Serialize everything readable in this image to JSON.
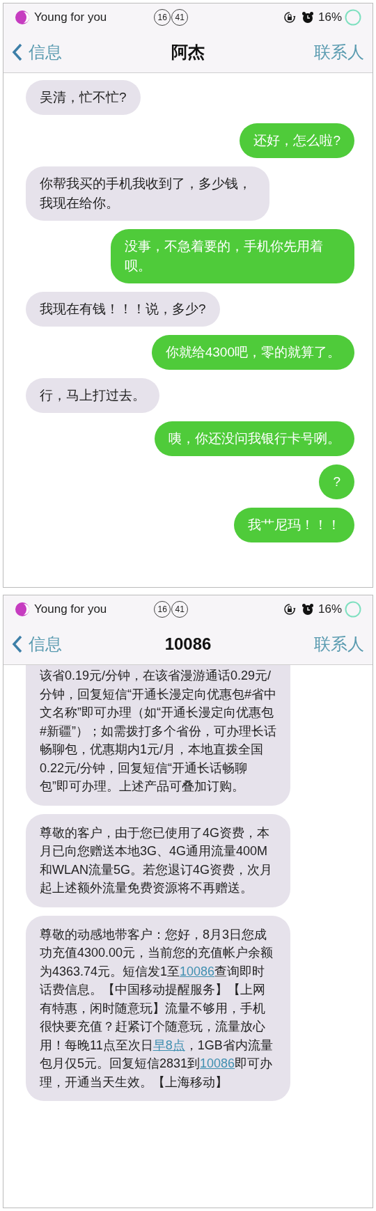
{
  "screens": [
    {
      "status_bar": {
        "carrier": "Young for you",
        "hour": "16",
        "minute": "41",
        "battery": "16%"
      },
      "nav": {
        "back": "信息",
        "title": "阿杰",
        "action": "联系人"
      },
      "messages": [
        {
          "kind": "received",
          "segments": [
            {
              "kind": "text",
              "text": "吴清，忙不忙?"
            }
          ]
        },
        {
          "kind": "sent",
          "segments": [
            {
              "kind": "text",
              "text": "还好，怎么啦?"
            }
          ]
        },
        {
          "kind": "received",
          "segments": [
            {
              "kind": "text",
              "text": "你帮我买的手机我收到了，多少钱，我现在给你。"
            }
          ]
        },
        {
          "kind": "sent",
          "segments": [
            {
              "kind": "text",
              "text": "没事，不急着要的，手机你先用着呗。"
            }
          ]
        },
        {
          "kind": "received",
          "segments": [
            {
              "kind": "text",
              "text": "我现在有钱！！！说，多少?"
            }
          ]
        },
        {
          "kind": "sent",
          "segments": [
            {
              "kind": "text",
              "text": "你就给4300吧，零的就算了。"
            }
          ]
        },
        {
          "kind": "received",
          "segments": [
            {
              "kind": "text",
              "text": "行，马上打过去。"
            }
          ]
        },
        {
          "kind": "sent",
          "segments": [
            {
              "kind": "text",
              "text": "咦，你还没问我银行卡号咧。"
            }
          ]
        },
        {
          "kind": "sent",
          "segments": [
            {
              "kind": "text",
              "text": "?"
            }
          ]
        },
        {
          "kind": "sent",
          "segments": [
            {
              "kind": "text",
              "text": "我艹尼玛！！！"
            }
          ]
        }
      ]
    },
    {
      "status_bar": {
        "carrier": "Young for you",
        "hour": "16",
        "minute": "41",
        "battery": "16%"
      },
      "nav": {
        "back": "信息",
        "title": "10086",
        "action": "联系人"
      },
      "messages": [
        {
          "kind": "received_cut",
          "segments": [
            {
              "kind": "text",
              "text": "该省0.19元/分钟，在该省漫游通话0.29元/分钟，回复短信“开通长漫定向优惠包#省中文名称”即可办理（如“开通长漫定向优惠包#新疆”）；如需拨打多个省份，可办理长话畅聊包，优惠期内1元/月，本地直拨全国0.22元/分钟，回复短信“开通长话畅聊包”即可办理。上述产品可叠加订购。"
            }
          ]
        },
        {
          "kind": "received",
          "segments": [
            {
              "kind": "text",
              "text": "尊敬的客户，由于您已使用了4G资费，本月已向您赠送本地3G、4G通用流量400M和WLAN流量5G。若您退订4G资费，次月起上述额外流量免费资源将不再赠送。"
            }
          ]
        },
        {
          "kind": "received",
          "segments": [
            {
              "kind": "text",
              "text": "尊敬的动感地带客户：您好，8月3日您成功充值4300.00元，当前您的充值帐户余额为4363.74元。短信发1至"
            },
            {
              "kind": "link",
              "text": "10086"
            },
            {
              "kind": "text",
              "text": "查询即时话费信息。【中国移动提醒服务】【上网有特惠，闲时随意玩】流量不够用，手机很快要充值？赶紧订个随意玩，流量放心用！每晚11点至次日"
            },
            {
              "kind": "link",
              "text": "早8点"
            },
            {
              "kind": "text",
              "text": "，1GB省内流量包月仅5元。回复短信2831到"
            },
            {
              "kind": "link",
              "text": "10086"
            },
            {
              "kind": "text",
              "text": "即可办理，开通当天生效。【上海移动】"
            }
          ]
        }
      ]
    }
  ]
}
